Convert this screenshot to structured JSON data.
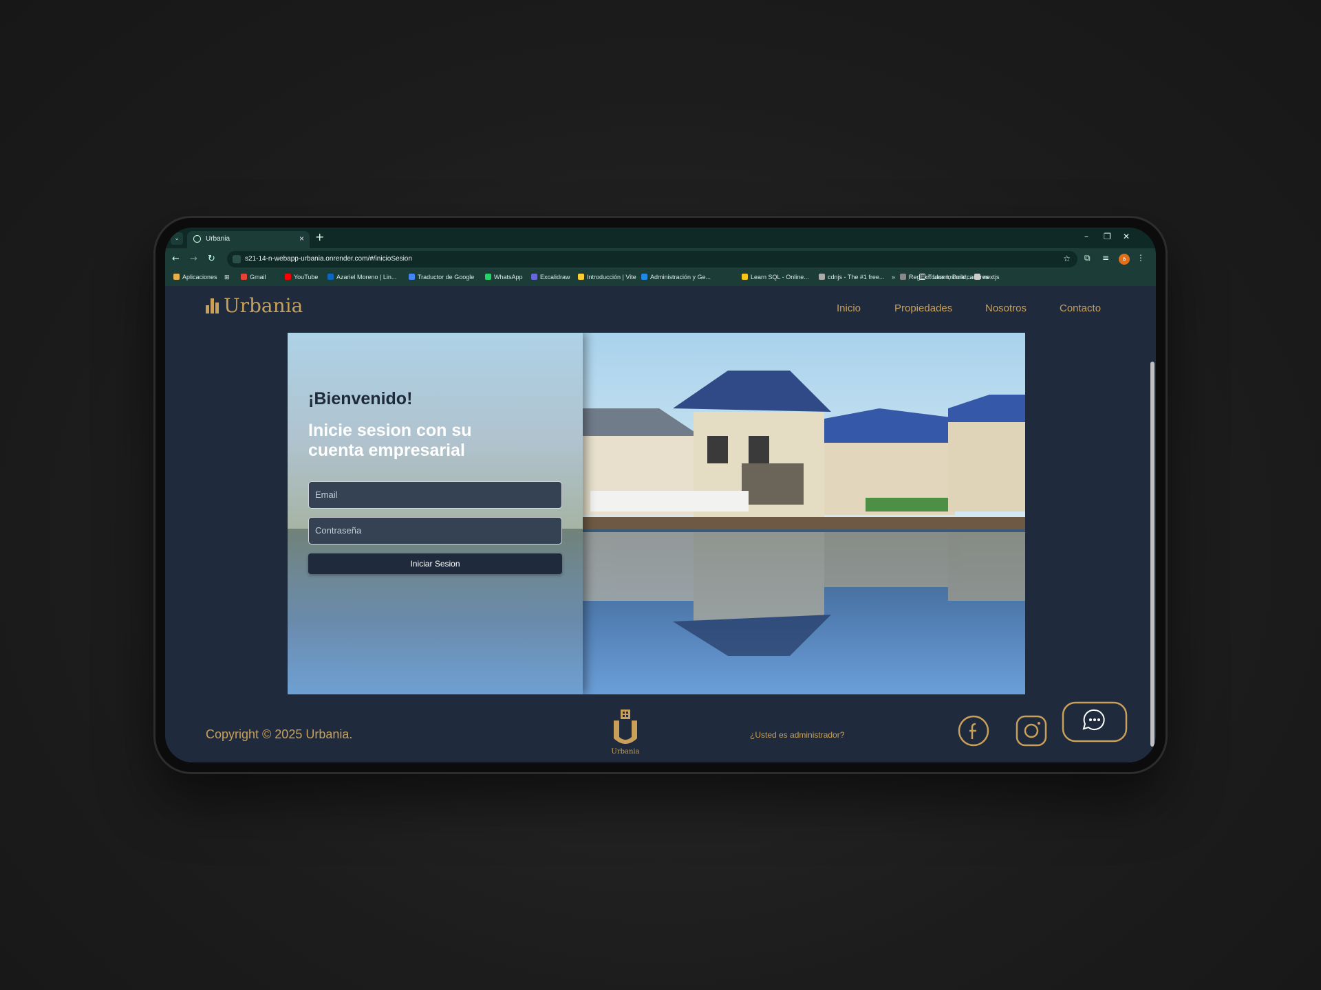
{
  "browser": {
    "tab_title": "Urbania",
    "url": "s21-14-n-webapp-urbania.onrender.com/#/inicioSesion",
    "bookmarks": [
      {
        "label": "Aplicaciones",
        "color": "#e8b04a"
      },
      {
        "label": "Gmail",
        "color": "#ea4335"
      },
      {
        "label": "YouTube",
        "color": "#ff0000"
      },
      {
        "label": "Azariel Moreno | Lin...",
        "color": "#0a66c2"
      },
      {
        "label": "Traductor de Google",
        "color": "#4285f4"
      },
      {
        "label": "WhatsApp",
        "color": "#25d366"
      },
      {
        "label": "Excalidraw",
        "color": "#6965db"
      },
      {
        "label": "Introducción | Vite",
        "color": "#ffcc33"
      },
      {
        "label": "Administración y Ge...",
        "color": "#1e88e5"
      },
      {
        "label": "Learn SQL - Online...",
        "color": "#f5c518"
      },
      {
        "label": "cdnjs - The #1 free...",
        "color": "#aaaaaa"
      },
      {
        "label": "RegExr: Learn, Build,...",
        "color": "#888888"
      },
      {
        "label": "nextjs",
        "color": "#cccccc"
      }
    ],
    "all_bookmarks": "Todos los marcadores",
    "profile_initial": "a"
  },
  "header": {
    "logo": "Urbania",
    "nav": [
      "Inicio",
      "Propiedades",
      "Nosotros",
      "Contacto"
    ]
  },
  "login": {
    "welcome": "¡Bienvenido!",
    "subtitle": "Inicie sesion con su cuenta empresarial",
    "email_placeholder": "Email",
    "password_placeholder": "Contraseña",
    "submit_label": "Iniciar Sesion"
  },
  "footer": {
    "copyright": "Copyright © 2025 Urbania.",
    "footer_logo_text": "Urbania",
    "admin_link": "¿Usted es administrador?",
    "social_icons": [
      "facebook-icon",
      "instagram-icon"
    ],
    "chat_icon": "chat-bubble-icon"
  },
  "colors": {
    "accent": "#c9a05a",
    "page_bg": "#1f2b3c",
    "browser_chrome": "#1c3d37"
  }
}
